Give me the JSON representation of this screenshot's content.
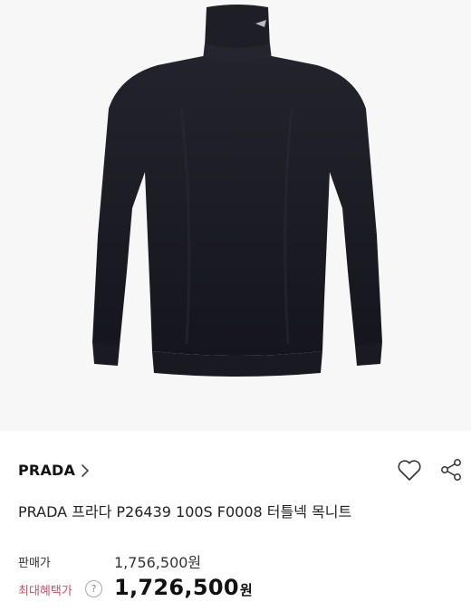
{
  "product": {
    "image_alt": "black turtleneck sweater",
    "brand": "PRADA",
    "title": "PRADA 프라다 P26439 100S F0008 터틀넥 목니트"
  },
  "price": {
    "sale_label": "판매가",
    "sale_value": "1,756,500원",
    "best_label": "최대혜택가",
    "best_help": "?",
    "best_number": "1,726,500",
    "best_unit": "원"
  },
  "icons": {
    "brand_chevron": "chevron-right-icon",
    "wishlist": "heart-icon",
    "share": "share-icon"
  },
  "colors": {
    "accent": "#e0455c",
    "sweater": "#1b1c24"
  }
}
